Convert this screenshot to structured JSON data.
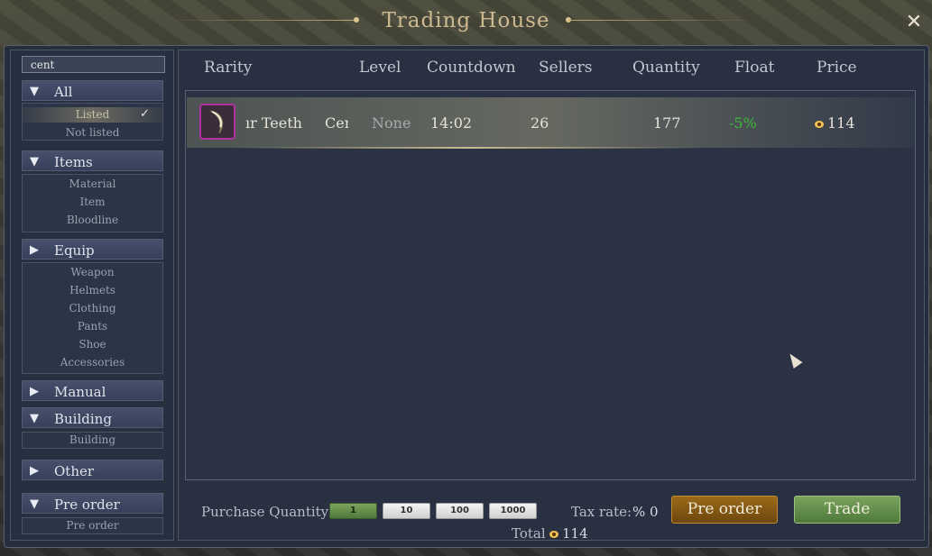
{
  "window": {
    "title": "Trading House",
    "close_icon": "close-icon"
  },
  "search": {
    "value": "cent"
  },
  "sidebar": {
    "categories": [
      {
        "label": "All",
        "expanded": true,
        "items": [
          "Listed",
          "Not listed"
        ],
        "selected": "Listed"
      },
      {
        "label": "Items",
        "expanded": true,
        "items": [
          "Material",
          "Item",
          "Bloodline"
        ]
      },
      {
        "label": "Equip",
        "expanded": false,
        "items": [
          "Weapon",
          "Helmets",
          "Clothing",
          "Pants",
          "Shoe",
          "Accessories"
        ]
      },
      {
        "label": "Manual",
        "expanded": false,
        "items": []
      },
      {
        "label": "Building",
        "expanded": true,
        "items": [
          "Building"
        ]
      },
      {
        "label": "Other",
        "expanded": false,
        "items": []
      },
      {
        "label": "Pre order",
        "expanded": true,
        "items": [
          "Pre order"
        ]
      }
    ]
  },
  "table": {
    "headers": [
      "Rarity",
      "Level",
      "Countdown",
      "Sellers",
      "Quantity",
      "Float",
      "Price"
    ],
    "rows": [
      {
        "name": "ır Teeth",
        "rarity": "Cer",
        "level": "None",
        "countdown": "14:02",
        "sellers": "26",
        "quantity": "177",
        "float": "-5%",
        "price": "114"
      }
    ]
  },
  "footer": {
    "purchase_quantity_label": "Purchase Quantity",
    "quantity_options": [
      "1",
      "10",
      "100",
      "1000"
    ],
    "selected_quantity": "1",
    "tax_label": "Tax rate:",
    "tax_value": "% 0",
    "total_label": "Total",
    "total_value": "114",
    "preorder_label": "Pre order",
    "trade_label": "Trade"
  },
  "colors": {
    "float_negative": "#3dbb3a",
    "preorder_btn": "#8a5c14",
    "trade_btn": "#6a9450",
    "rarity_border": "#b030a0"
  }
}
